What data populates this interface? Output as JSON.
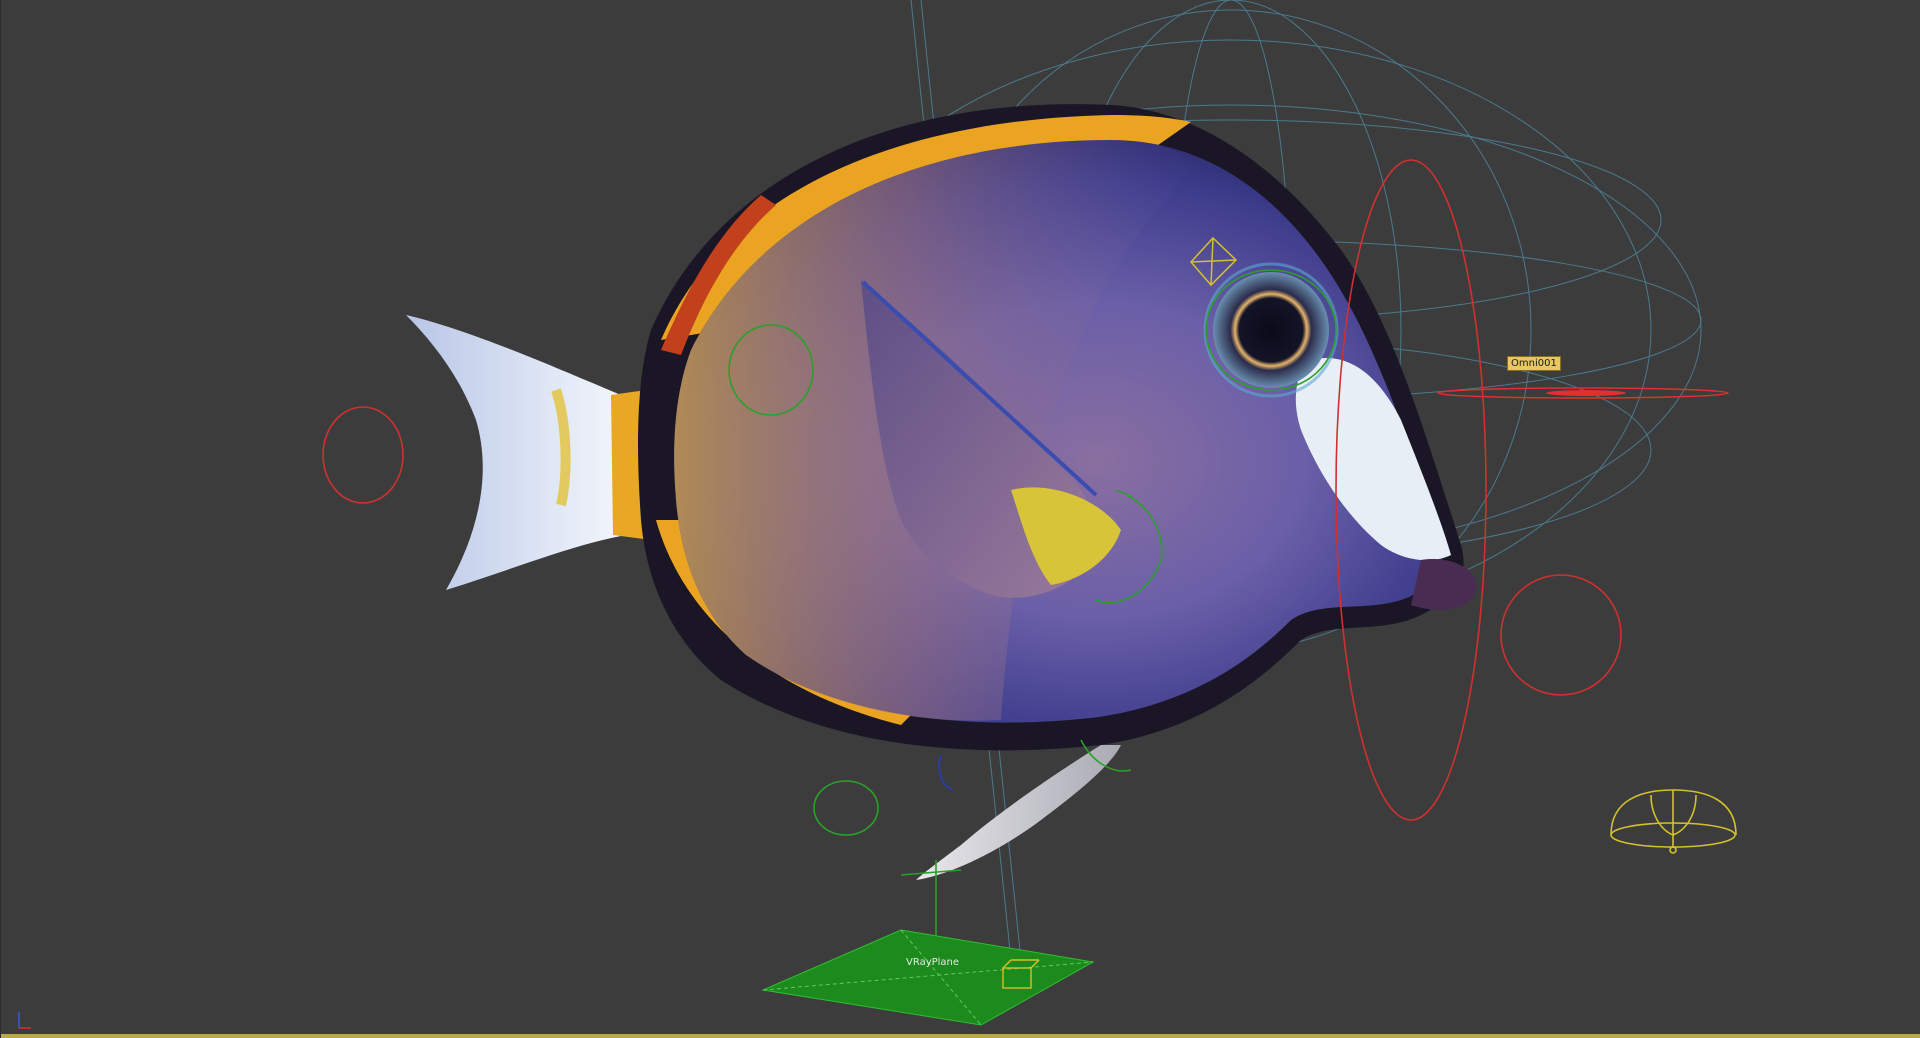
{
  "viewport": {
    "background": "#3c3c3c"
  },
  "scene_objects": {
    "omni_light": {
      "label": "Omni001",
      "color": "#e03030"
    },
    "vray_plane": {
      "label": "VRayPlane",
      "color": "#1c8a1c"
    },
    "fish": {
      "icon": "fish-model-icon"
    },
    "dome_light": {
      "icon": "dome-light-icon",
      "color": "#d4c22a"
    },
    "control_circles": {
      "red": "#d03030",
      "green": "#2aa02a",
      "cyan_wire": "#4f8fa8"
    }
  }
}
